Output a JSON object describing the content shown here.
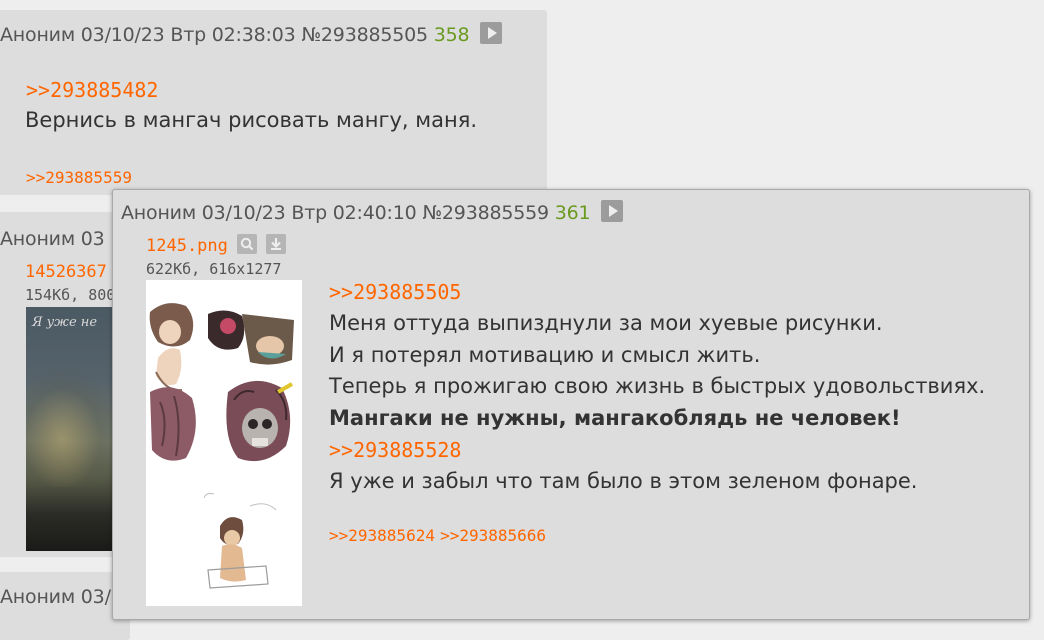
{
  "post_top": {
    "author": "Аноним",
    "datetime": "03/10/23 Втр 02:38:03",
    "number": "№293885505",
    "counter": "358",
    "quote_link": ">>293885482",
    "text": "Вернись в мангач рисовать мангу, маня.",
    "replies": ">>293885559"
  },
  "post_mid": {
    "author": "Аноним",
    "datetime_partial": "03",
    "file_name_partial": "14526367",
    "file_info_partial": "154Кб, 800",
    "image_caption_partial": "Я уже не"
  },
  "post_bottom": {
    "author": "Аноним",
    "datetime_partial": "03/"
  },
  "popup": {
    "author": "Аноним",
    "datetime": "03/10/23 Втр 02:40:10",
    "number": "№293885559",
    "counter": "361",
    "file_name": "1245.png",
    "file_info": "622Кб, 616x1277",
    "lines": [
      {
        "type": "link",
        "text": ">>293885505"
      },
      {
        "type": "text",
        "text": "Меня оттуда выпизднули за мои хуевые рисунки."
      },
      {
        "type": "text",
        "text": "И я потерял мотивацию и смысл жить."
      },
      {
        "type": "text",
        "text": "Теперь я прожигаю свою жизнь в быстрых удовольствиях."
      },
      {
        "type": "bold",
        "text": "Мангаки не нужны, мангакоблядь не человек!"
      },
      {
        "type": "link",
        "text": ">>293885528"
      },
      {
        "type": "text",
        "text": "Я уже и забыл что там было в этом зеленом фонаре."
      }
    ],
    "replies": [
      ">>293885624",
      ">>293885666"
    ]
  },
  "icons": {
    "play": "play-icon",
    "search": "magnifier-icon",
    "download": "download-icon"
  },
  "colors": {
    "link": "#ff6600",
    "counter": "#6a9a1f",
    "post_bg": "#dddddd",
    "page_bg": "#eeeeee"
  }
}
